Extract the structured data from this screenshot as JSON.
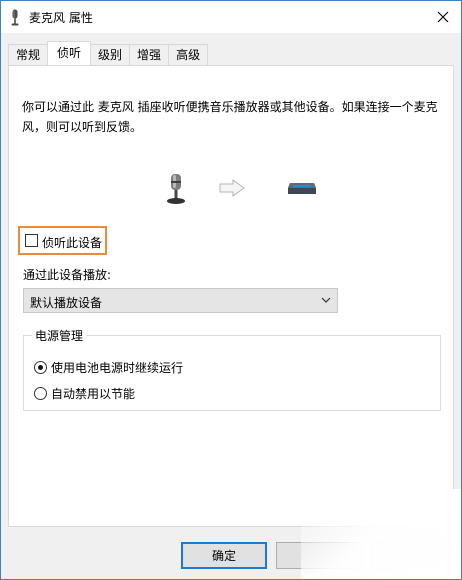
{
  "window": {
    "title": "麦克风 属性",
    "icon": "microphone-icon"
  },
  "tabs": [
    {
      "label": "常规",
      "active": false
    },
    {
      "label": "侦听",
      "active": true
    },
    {
      "label": "级别",
      "active": false
    },
    {
      "label": "增强",
      "active": false
    },
    {
      "label": "高级",
      "active": false
    }
  ],
  "listen": {
    "description": "你可以通过此 麦克风 插座收听便携音乐播放器或其他设备。如果连接一个麦克风，则可以听到反馈。",
    "checkbox_label": "侦听此设备",
    "checkbox_checked": false,
    "highlight_color": "#e98b3a",
    "playback_label": "通过此设备播放:",
    "playback_value": "默认播放设备"
  },
  "power": {
    "group_title": "电源管理",
    "options": [
      {
        "label": "使用电池电源时继续运行",
        "checked": true
      },
      {
        "label": "自动禁用以节能",
        "checked": false
      }
    ]
  },
  "buttons": {
    "ok": "确定"
  },
  "colors": {
    "accent": "#1a7ad4",
    "window_border": "#3a84c6"
  }
}
